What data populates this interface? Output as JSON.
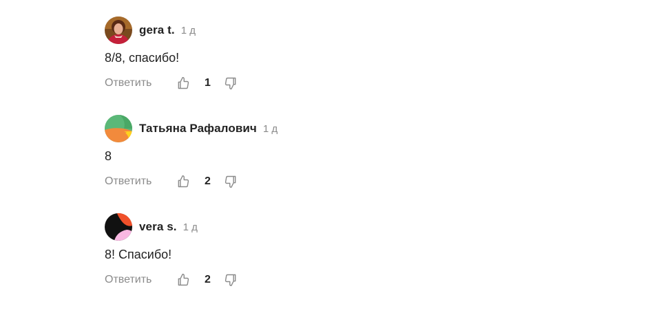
{
  "comments": [
    {
      "author": "gera t.",
      "time": "1 д",
      "text": "8/8, спасибо!",
      "reply_label": "Ответить",
      "likes": "1",
      "avatar": "photo-avatar"
    },
    {
      "author": "Татьяна Рафалович",
      "time": "1 д",
      "text": "8",
      "reply_label": "Ответить",
      "likes": "2",
      "avatar": "generated-avatar-green-orange-yellow"
    },
    {
      "author": "vera s.",
      "time": "1 д",
      "text": "8! Спасибо!",
      "reply_label": "Ответить",
      "likes": "2",
      "avatar": "generated-avatar-black-orange-pink"
    }
  ],
  "icons": {
    "like": "thumbs-up-icon",
    "dislike": "thumbs-down-icon"
  },
  "colors": {
    "muted_text": "#8a8a8a",
    "main_text": "#222222"
  }
}
